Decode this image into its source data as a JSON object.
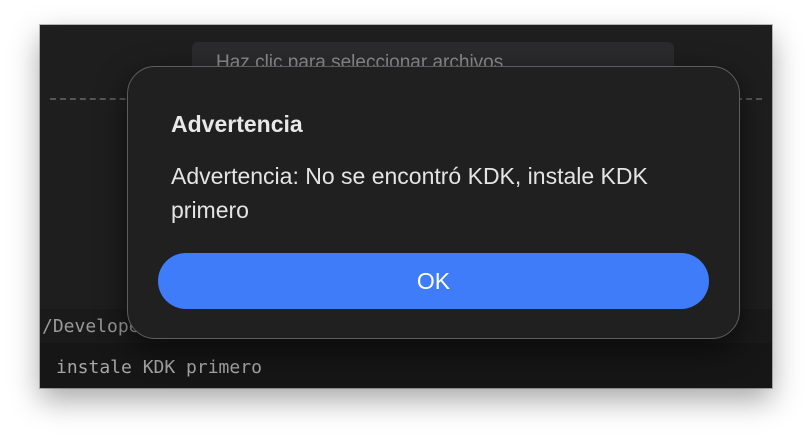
{
  "background": {
    "drop_hint": "Haz clic para seleccionar archivos",
    "log_path": "/Developer/KDKs",
    "log_message": "instale KDK primero"
  },
  "dialog": {
    "title": "Advertencia",
    "message": "Advertencia: No se encontró KDK, instale KDK primero",
    "ok_label": "OK"
  },
  "colors": {
    "accent": "#3e7cf9",
    "dialog_bg": "#202020",
    "window_bg": "#1e1e1e"
  }
}
